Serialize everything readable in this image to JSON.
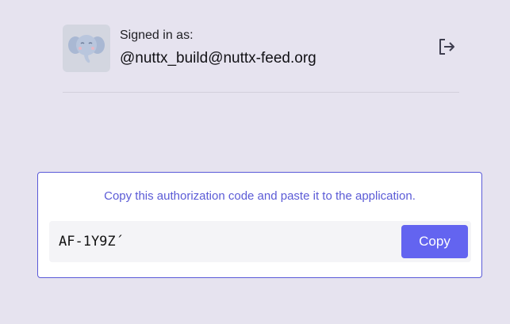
{
  "account": {
    "signed_in_label": "Signed in as:",
    "username": "@nuttx_build@nuttx-feed.org",
    "avatar_icon": "elephant-mascot-icon",
    "logout_icon": "logout-icon"
  },
  "auth": {
    "instruction": "Copy this authorization code and paste it to the application.",
    "code_value": "AF-1Y9Z´",
    "copy_label": "Copy"
  },
  "colors": {
    "background": "#e6e3ef",
    "accent": "#6364f0",
    "accent_text": "#5b5bd6",
    "card_border": "#5a5ad8"
  }
}
